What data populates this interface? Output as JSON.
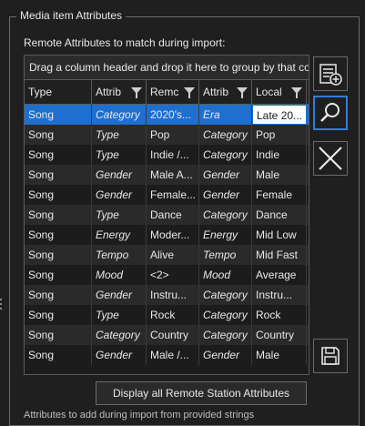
{
  "group": {
    "legend": "Media item Attributes",
    "sublabel": "Remote Attributes to match during import:",
    "group_panel": "Drag a column header and drop it here to group by that co",
    "columns": [
      "Type",
      "Attrib",
      "Remc",
      "Attrib",
      "Local"
    ],
    "rows": [
      [
        "Song",
        "Category",
        "2020's...",
        "Era",
        "Late 20..."
      ],
      [
        "Song",
        "Type",
        "Pop",
        "Category",
        "Pop"
      ],
      [
        "Song",
        "Type",
        "Indie /...",
        "Category",
        "Indie"
      ],
      [
        "Song",
        "Gender",
        "Male A...",
        "Gender",
        "Male"
      ],
      [
        "Song",
        "Gender",
        "Female...",
        "Gender",
        "Female"
      ],
      [
        "Song",
        "Type",
        "Dance",
        "Category",
        "Dance"
      ],
      [
        "Song",
        "Energy",
        "Moder...",
        "Energy",
        "Mid Low"
      ],
      [
        "Song",
        "Tempo",
        "Alive",
        "Tempo",
        "Mid Fast"
      ],
      [
        "Song",
        "Mood",
        "<2>",
        "Mood",
        "Average"
      ],
      [
        "Song",
        "Gender",
        "Instru...",
        "Category",
        "Instru..."
      ],
      [
        "Song",
        "Type",
        "Rock",
        "Category",
        "Rock"
      ],
      [
        "Song",
        "Category",
        "Country",
        "Category",
        "Country"
      ],
      [
        "Song",
        "Gender",
        "Male /...",
        "Gender",
        "Male"
      ]
    ],
    "display_button": "Display all Remote Station Attributes",
    "footer_text": "Attributes to add during import from provided strings"
  },
  "icons": {
    "add": "add-list-icon",
    "search": "search-icon",
    "delete": "close-icon",
    "save": "save-icon"
  }
}
